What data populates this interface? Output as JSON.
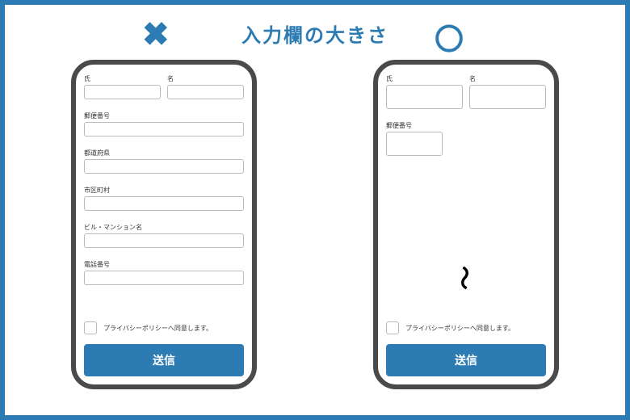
{
  "title": "入力欄の大きさ",
  "mark_bad": "✖",
  "mark_good": "〇",
  "bad": {
    "fields": {
      "lastname": "氏",
      "firstname": "名",
      "postal": "郵便番号",
      "prefecture": "都道府県",
      "city": "市区町村",
      "building": "ビル・マンション名",
      "phone": "電話番号"
    },
    "privacy": "プライバシーポリシーへ同意します。",
    "submit": "送信"
  },
  "good": {
    "fields": {
      "lastname": "氏",
      "firstname": "名",
      "postal": "郵便番号"
    },
    "privacy": "プライバシーポリシーへ同意します。",
    "submit": "送信",
    "ellipsis": "〜"
  }
}
